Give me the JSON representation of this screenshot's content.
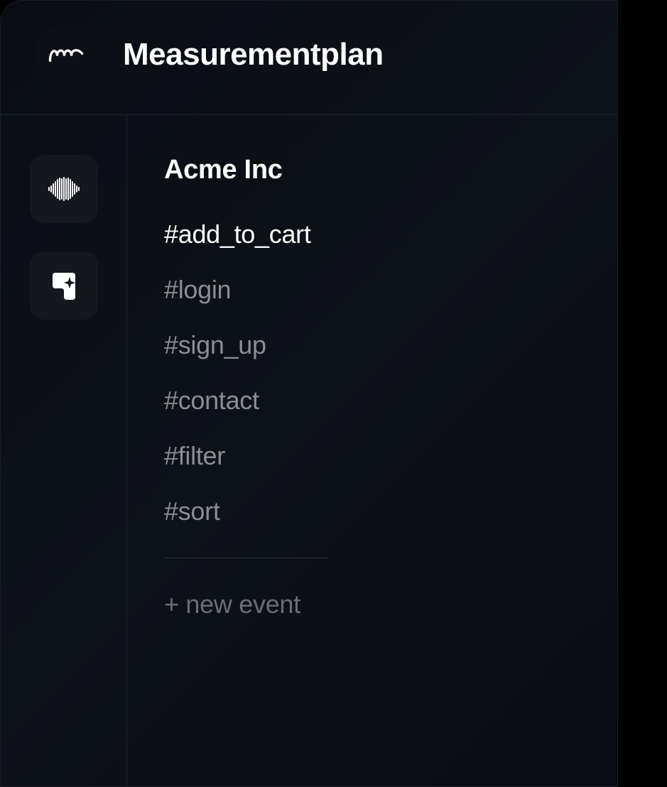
{
  "header": {
    "title": "Measurementplan"
  },
  "workspace": {
    "name": "Acme Inc"
  },
  "events": [
    {
      "label": "#add_to_cart",
      "active": true
    },
    {
      "label": "#login",
      "active": false
    },
    {
      "label": "#sign_up",
      "active": false
    },
    {
      "label": "#contact",
      "active": false
    },
    {
      "label": "#filter",
      "active": false
    },
    {
      "label": "#sort",
      "active": false
    }
  ],
  "actions": {
    "new_event": "+ new event"
  },
  "rail": {
    "item1": "sound-wave-icon",
    "item2": "sparkle-shield-icon"
  }
}
